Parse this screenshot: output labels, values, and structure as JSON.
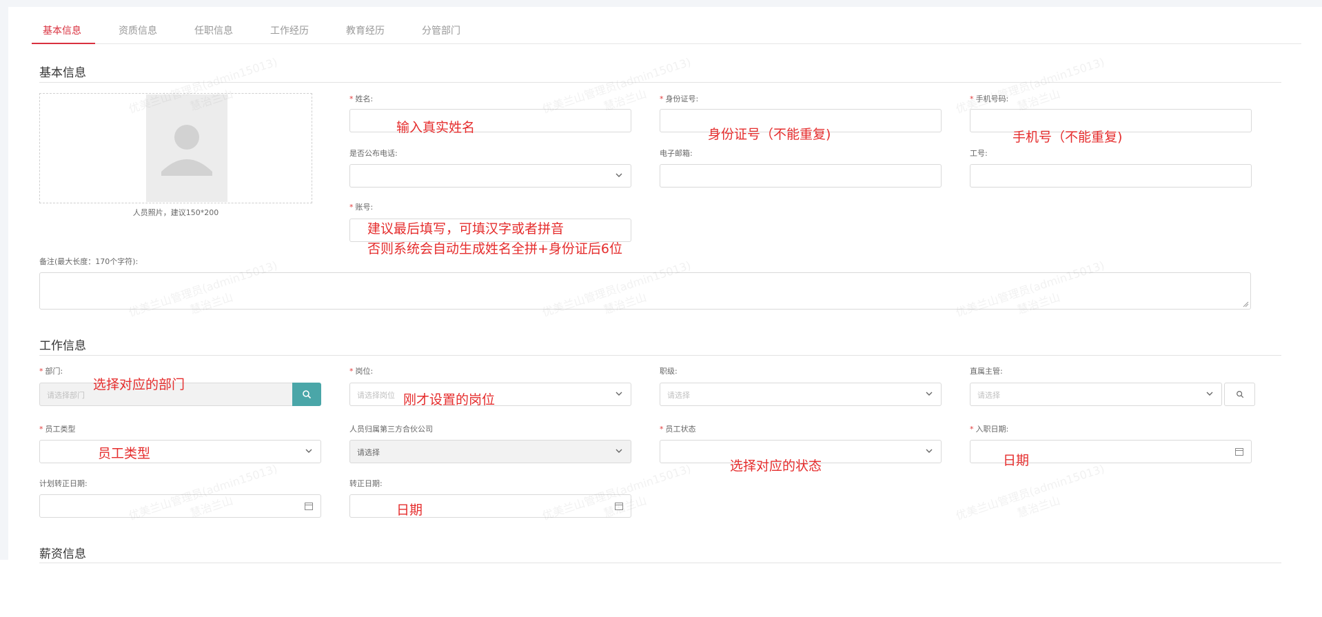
{
  "tabs": [
    {
      "label": "基本信息",
      "active": true
    },
    {
      "label": "资质信息"
    },
    {
      "label": "任职信息"
    },
    {
      "label": "工作经历"
    },
    {
      "label": "教育经历"
    },
    {
      "label": "分管部门"
    }
  ],
  "basic": {
    "title": "基本信息",
    "photo_caption": "人员照片，建议150*200",
    "name_label": "姓名:",
    "idcard_label": "身份证号:",
    "phone_label": "手机号码:",
    "publish_phone_label": "是否公布电话:",
    "email_label": "电子邮箱:",
    "job_no_label": "工号:",
    "account_label": "账号:",
    "remark_label": "备注(最大长度：170个字符):"
  },
  "work": {
    "title": "工作信息",
    "dept_label": "部门:",
    "dept_placeholder": "请选择部门",
    "post_label": "岗位:",
    "post_placeholder": "请选择岗位",
    "rank_label": "职级:",
    "rank_placeholder": "请选择",
    "supervisor_label": "直属主管:",
    "supervisor_placeholder": "请选择",
    "emp_type_label": "员工类型",
    "partner_label": "人员归属第三方合伙公司",
    "partner_value": "请选择",
    "emp_status_label": "员工状态",
    "entry_date_label": "入职日期:",
    "plan_regular_label": "计划转正日期:",
    "regular_date_label": "转正日期:"
  },
  "salary": {
    "title": "薪资信息"
  },
  "annotations": {
    "name": "输入真实姓名",
    "idcard": "身份证号（不能重复)",
    "phone": "手机号（不能重复)",
    "account_line1": "建议最后填写，可填汉字或者拼音",
    "account_line2": "否则系统会自动生成姓名全拼+身份证后6位",
    "dept": "选择对应的部门",
    "post": "刚才设置的岗位",
    "emp_type": "员工类型",
    "emp_status": "选择对应的状态",
    "entry_date": "日期",
    "regular_date": "日期"
  },
  "watermark": {
    "line1": "优美兰山管理员(admin15013)",
    "line2": "慧治兰山"
  },
  "colors": {
    "accent": "#d9303e",
    "button_teal": "#4aa6a8",
    "annotation": "#e52d2d"
  }
}
